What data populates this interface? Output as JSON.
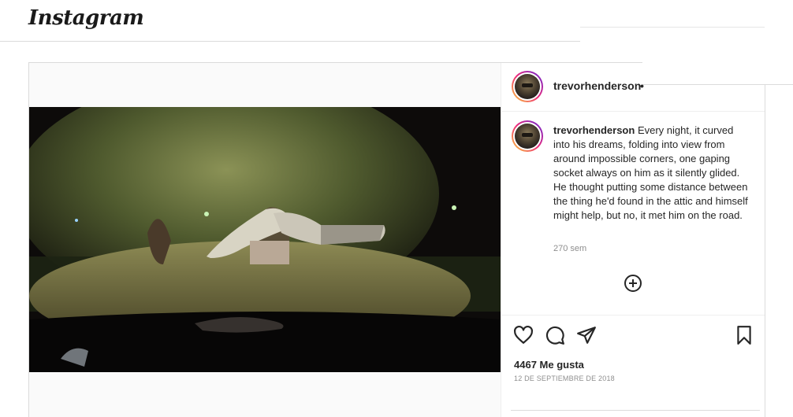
{
  "app": {
    "logo_text": "Instagram"
  },
  "post": {
    "username": "trevorhenderson",
    "dot": "•",
    "caption": "Every night, it curved into his dreams, folding into view from around impossible corners, one gaping socket always on him as it silently glided. He thought putting some distance between the thing he'd found in the attic and himself might help, but no, it met him on the road.",
    "time_ago": "270 sem",
    "likes": "4467 Me gusta",
    "date": "12 DE SEPTIEMBRE DE 2018"
  },
  "icons": {
    "like": "heart-icon",
    "comment": "comment-icon",
    "share": "share-icon",
    "save": "bookmark-icon",
    "add_comment": "plus-circle-icon"
  },
  "colors": {
    "text": "#262626",
    "secondary": "#8e8e8e",
    "border": "#dbdbdb"
  }
}
